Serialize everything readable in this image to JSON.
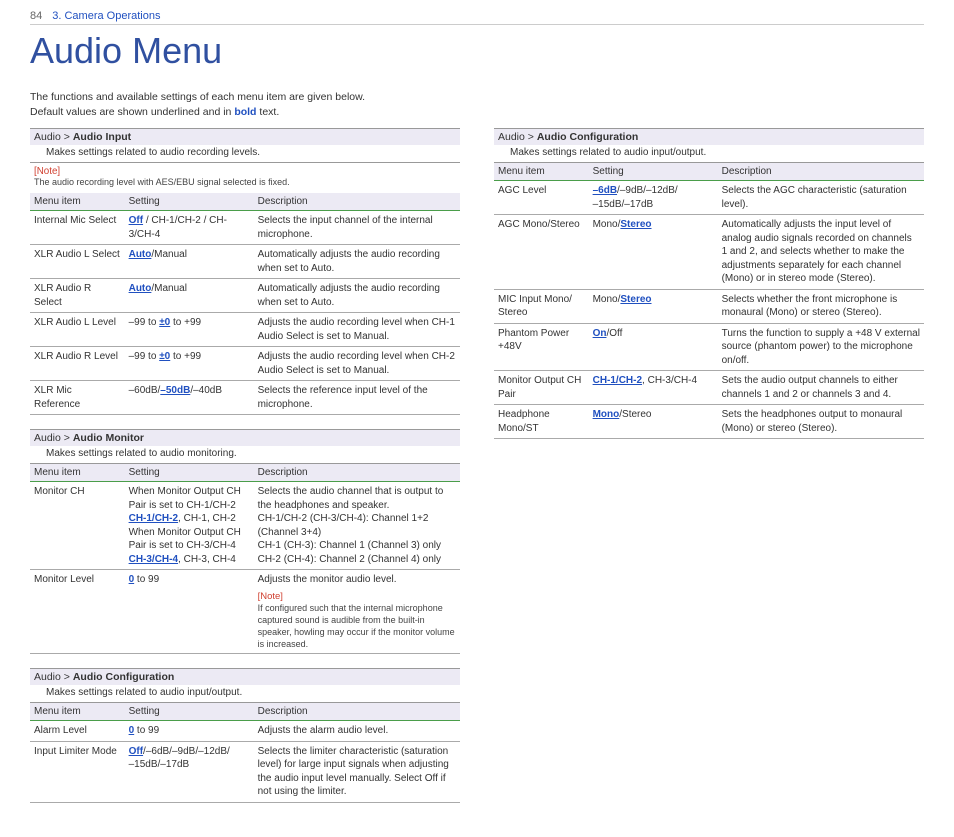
{
  "header": {
    "pageNum": "84",
    "section": "3. Camera Operations"
  },
  "title": "Audio Menu",
  "intro": {
    "line1": "The functions and available settings of each menu item are given below.",
    "line2a": "Default values are shown underlined and in ",
    "line2b": "bold",
    "line2c": " text."
  },
  "headers": {
    "item": "Menu item",
    "setting": "Setting",
    "desc": "Description"
  },
  "blocks": {
    "audioInput": {
      "path": "Audio > ",
      "name": "Audio Input",
      "sub": "Makes settings related to audio recording levels.",
      "noteLabel": "[Note]",
      "noteText": "The audio recording level with AES/EBU signal selected is fixed.",
      "rows": [
        {
          "item": "Internal Mic Select",
          "def": "Off",
          "rest": " / CH-1/CH-2 / CH-3/CH-4",
          "desc": "Selects the input channel of the internal microphone."
        },
        {
          "item": "XLR Audio L Select",
          "def": "Auto",
          "rest": "/Manual",
          "desc": "Automatically adjusts the audio recording when set to Auto."
        },
        {
          "item": "XLR Audio R Select",
          "def": "Auto",
          "rest": "/Manual",
          "desc": "Automatically adjusts the audio recording when set to Auto."
        },
        {
          "item": "XLR Audio L Level",
          "pre": "–99 to ",
          "def": "±0",
          "rest": " to +99",
          "desc": "Adjusts the audio recording level when CH-1 Audio Select is set to Manual."
        },
        {
          "item": "XLR Audio R Level",
          "pre": "–99 to ",
          "def": "±0",
          "rest": " to +99",
          "desc": "Adjusts the audio recording level when CH-2 Audio Select is set to Manual."
        },
        {
          "item": "XLR Mic Reference",
          "pre": "–60dB/",
          "def": "–50dB",
          "rest": "/–40dB",
          "desc": "Selects the reference input level of the microphone."
        }
      ]
    },
    "audioMonitor": {
      "path": "Audio > ",
      "name": "Audio Monitor",
      "sub": "Makes settings related to audio monitoring.",
      "rows": [
        {
          "item": "Monitor CH",
          "settingLines": {
            "l1": "When Monitor Output CH Pair is set to CH-1/CH-2",
            "d1": "CH-1/CH-2",
            "r1": ", CH-1, CH-2",
            "l2": "When Monitor Output CH Pair is set to CH-3/CH-4",
            "d2": "CH-3/CH-4",
            "r2": ", CH-3, CH-4"
          },
          "descLines": {
            "l1": "Selects the audio channel that is output to the headphones and speaker.",
            "l2": "CH-1/CH-2 (CH-3/CH-4): Channel 1+2 (Channel 3+4)",
            "l3": "CH-1 (CH-3): Channel 1 (Channel 3) only",
            "l4": "CH-2 (CH-4): Channel 2 (Channel 4) only"
          }
        },
        {
          "item": "Monitor Level",
          "def": "0",
          "rest": " to 99",
          "desc": "Adjusts the monitor audio level.",
          "noteLabel": "[Note]",
          "noteText": "If configured such that the internal microphone captured sound is audible from the built-in speaker, howling may occur if the monitor volume is increased."
        }
      ]
    },
    "audioConfigLeft": {
      "path": "Audio > ",
      "name": "Audio Configuration",
      "sub": "Makes settings related to audio input/output.",
      "rows": [
        {
          "item": "Alarm Level",
          "def": "0",
          "rest": " to 99",
          "desc": "Adjusts the alarm audio level."
        },
        {
          "item": "Input Limiter Mode",
          "def": "Off",
          "rest": "/–6dB/–9dB/–12dB/\n–15dB/–17dB",
          "desc": "Selects the limiter characteristic (saturation level) for large input signals when adjusting the audio input level manually. Select Off if not using the limiter."
        }
      ]
    },
    "audioConfigRight": {
      "path": "Audio > ",
      "name": "Audio Configuration",
      "sub": "Makes settings related to audio input/output.",
      "rows": [
        {
          "item": "AGC Level",
          "def": "–6dB",
          "rest": "/–9dB/–12dB/\n–15dB/–17dB",
          "desc": "Selects the AGC characteristic (saturation level)."
        },
        {
          "item": "AGC Mono/Stereo",
          "pre": "Mono/",
          "def": "Stereo",
          "rest": "",
          "desc": "Automatically adjusts the input level of analog audio signals recorded on channels 1 and 2, and selects whether to make the adjustments separately for each channel (Mono) or in stereo mode (Stereo)."
        },
        {
          "item": "MIC Input Mono/\nStereo",
          "pre": "Mono/",
          "def": "Stereo",
          "rest": "",
          "desc": "Selects whether the front microphone is monaural (Mono) or stereo (Stereo)."
        },
        {
          "item": "Phantom Power +48V",
          "def": "On",
          "rest": "/Off",
          "desc": "Turns the function to supply a +48 V external source (phantom power) to the microphone on/off."
        },
        {
          "item": "Monitor Output CH Pair",
          "def": "CH-1/CH-2",
          "rest": ", CH-3/CH-4",
          "desc": "Sets the audio output channels to either channels 1 and 2 or channels 3 and 4."
        },
        {
          "item": "Headphone Mono/ST",
          "def": "Mono",
          "rest": "/Stereo",
          "desc": "Sets the headphones output to monaural (Mono) or stereo (Stereo)."
        }
      ]
    }
  }
}
